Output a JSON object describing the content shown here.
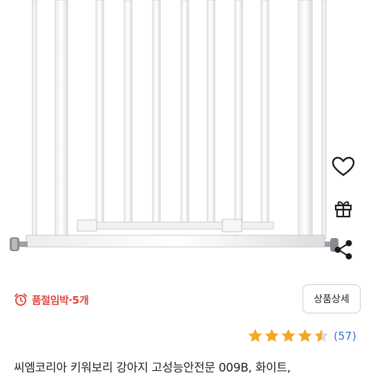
{
  "product_image": {
    "alt": "product photo - white pet safety gate"
  },
  "actions": {
    "wishlist_icon": "heart-outline-icon",
    "gift_icon": "gift-icon",
    "share_icon": "share-icon"
  },
  "stock": {
    "icon": "alarm-clock-icon",
    "label": "품절임박",
    "separator": "·",
    "count": "5개",
    "color": "#e4453b"
  },
  "detail_button": {
    "label": "상품상세"
  },
  "rating": {
    "value": 4.5,
    "max": 5,
    "reviews": "(57)",
    "star_color": "#f5a623",
    "empty_color": "#d9d9d9"
  },
  "product": {
    "title": "씨엠코리아 키워보리 강아지 고성능안전문 009B, 화이트,"
  }
}
